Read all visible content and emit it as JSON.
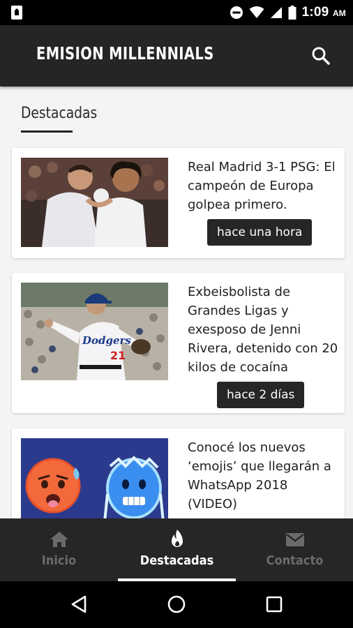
{
  "status_bar": {
    "time": "1:09",
    "ampm": "AM",
    "icons": [
      "sim-icon",
      "do-not-disturb-icon",
      "wifi-icon",
      "signal-icon",
      "battery-icon"
    ]
  },
  "app_bar": {
    "title": "EMISION MILLENNIALS",
    "search_icon": "search-icon"
  },
  "section": {
    "title": "Destacadas"
  },
  "articles": [
    {
      "title": "Real Madrid 3-1 PSG: El campeón de Europa golpea primero.",
      "time": "hace una hora",
      "image": "football-players-photo"
    },
    {
      "title": "Exbeisbolista de Grandes Ligas y exesposo de Jenni Rivera, detenido con 20 kilos de cocaína",
      "time": "hace 2 días",
      "image": "baseball-pitcher-photo"
    },
    {
      "title": "Conocé los nuevos ‘emojis’ que llegarán a WhatsApp 2018 (VIDEO)",
      "time": "",
      "image": "emoji-faces-image"
    }
  ],
  "bottom_nav": {
    "items": [
      {
        "label": "Inicio",
        "icon": "home-icon",
        "active": false
      },
      {
        "label": "Destacadas",
        "icon": "fire-icon",
        "active": true
      },
      {
        "label": "Contacto",
        "icon": "mail-icon",
        "active": false
      }
    ]
  },
  "colors": {
    "app_bar": "#252525",
    "background": "#f4f4f4",
    "badge": "#262626",
    "nav_inactive": "#6b6b6b"
  }
}
